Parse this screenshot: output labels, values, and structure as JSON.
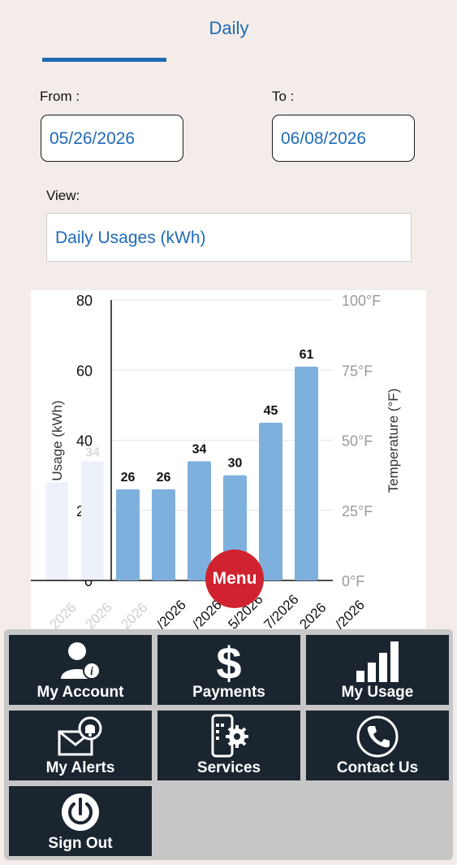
{
  "tabs": {
    "active_label": "Daily"
  },
  "filters": {
    "from_label": "From :",
    "from_value": "05/26/2026",
    "to_label": "To :",
    "to_value": "06/08/2026",
    "view_label": "View:",
    "view_value": "Daily Usages (kWh)"
  },
  "colors": {
    "accent": "#1f6ab5",
    "bar": "#7eb0de",
    "menu_button": "#d0232f",
    "tile_bg": "#1b2530"
  },
  "chart_data": {
    "type": "bar",
    "ylabel": "Usage (kWh)",
    "y2label": "Temperature (°F)",
    "ylim": [
      0,
      80
    ],
    "y_ticks": [
      "0",
      "20",
      "40",
      "60",
      "80"
    ],
    "y2_ticks": [
      "0°F",
      "25°F",
      "50°F",
      "75°F",
      "100°F"
    ],
    "grid": true,
    "visible_values": [
      26,
      26,
      34,
      30,
      45,
      61
    ],
    "faded_values": [
      28,
      34
    ],
    "faded_value_label": "34",
    "x_tick_labels": [
      "2026",
      "2026",
      "2026",
      "/2026",
      "/2026",
      "5/2026",
      "7/2026",
      "2026",
      "/2026"
    ]
  },
  "menu": {
    "button_label": "Menu",
    "tiles": [
      {
        "label": "My Account",
        "icon": "account-info-icon"
      },
      {
        "label": "Payments",
        "icon": "dollar-icon"
      },
      {
        "label": "My Usage",
        "icon": "usage-bars-icon"
      },
      {
        "label": "My Alerts",
        "icon": "alert-envelope-icon"
      },
      {
        "label": "Services",
        "icon": "phone-gear-icon"
      },
      {
        "label": "Contact Us",
        "icon": "phone-icon"
      },
      {
        "label": "Sign Out",
        "icon": "power-icon"
      }
    ]
  }
}
